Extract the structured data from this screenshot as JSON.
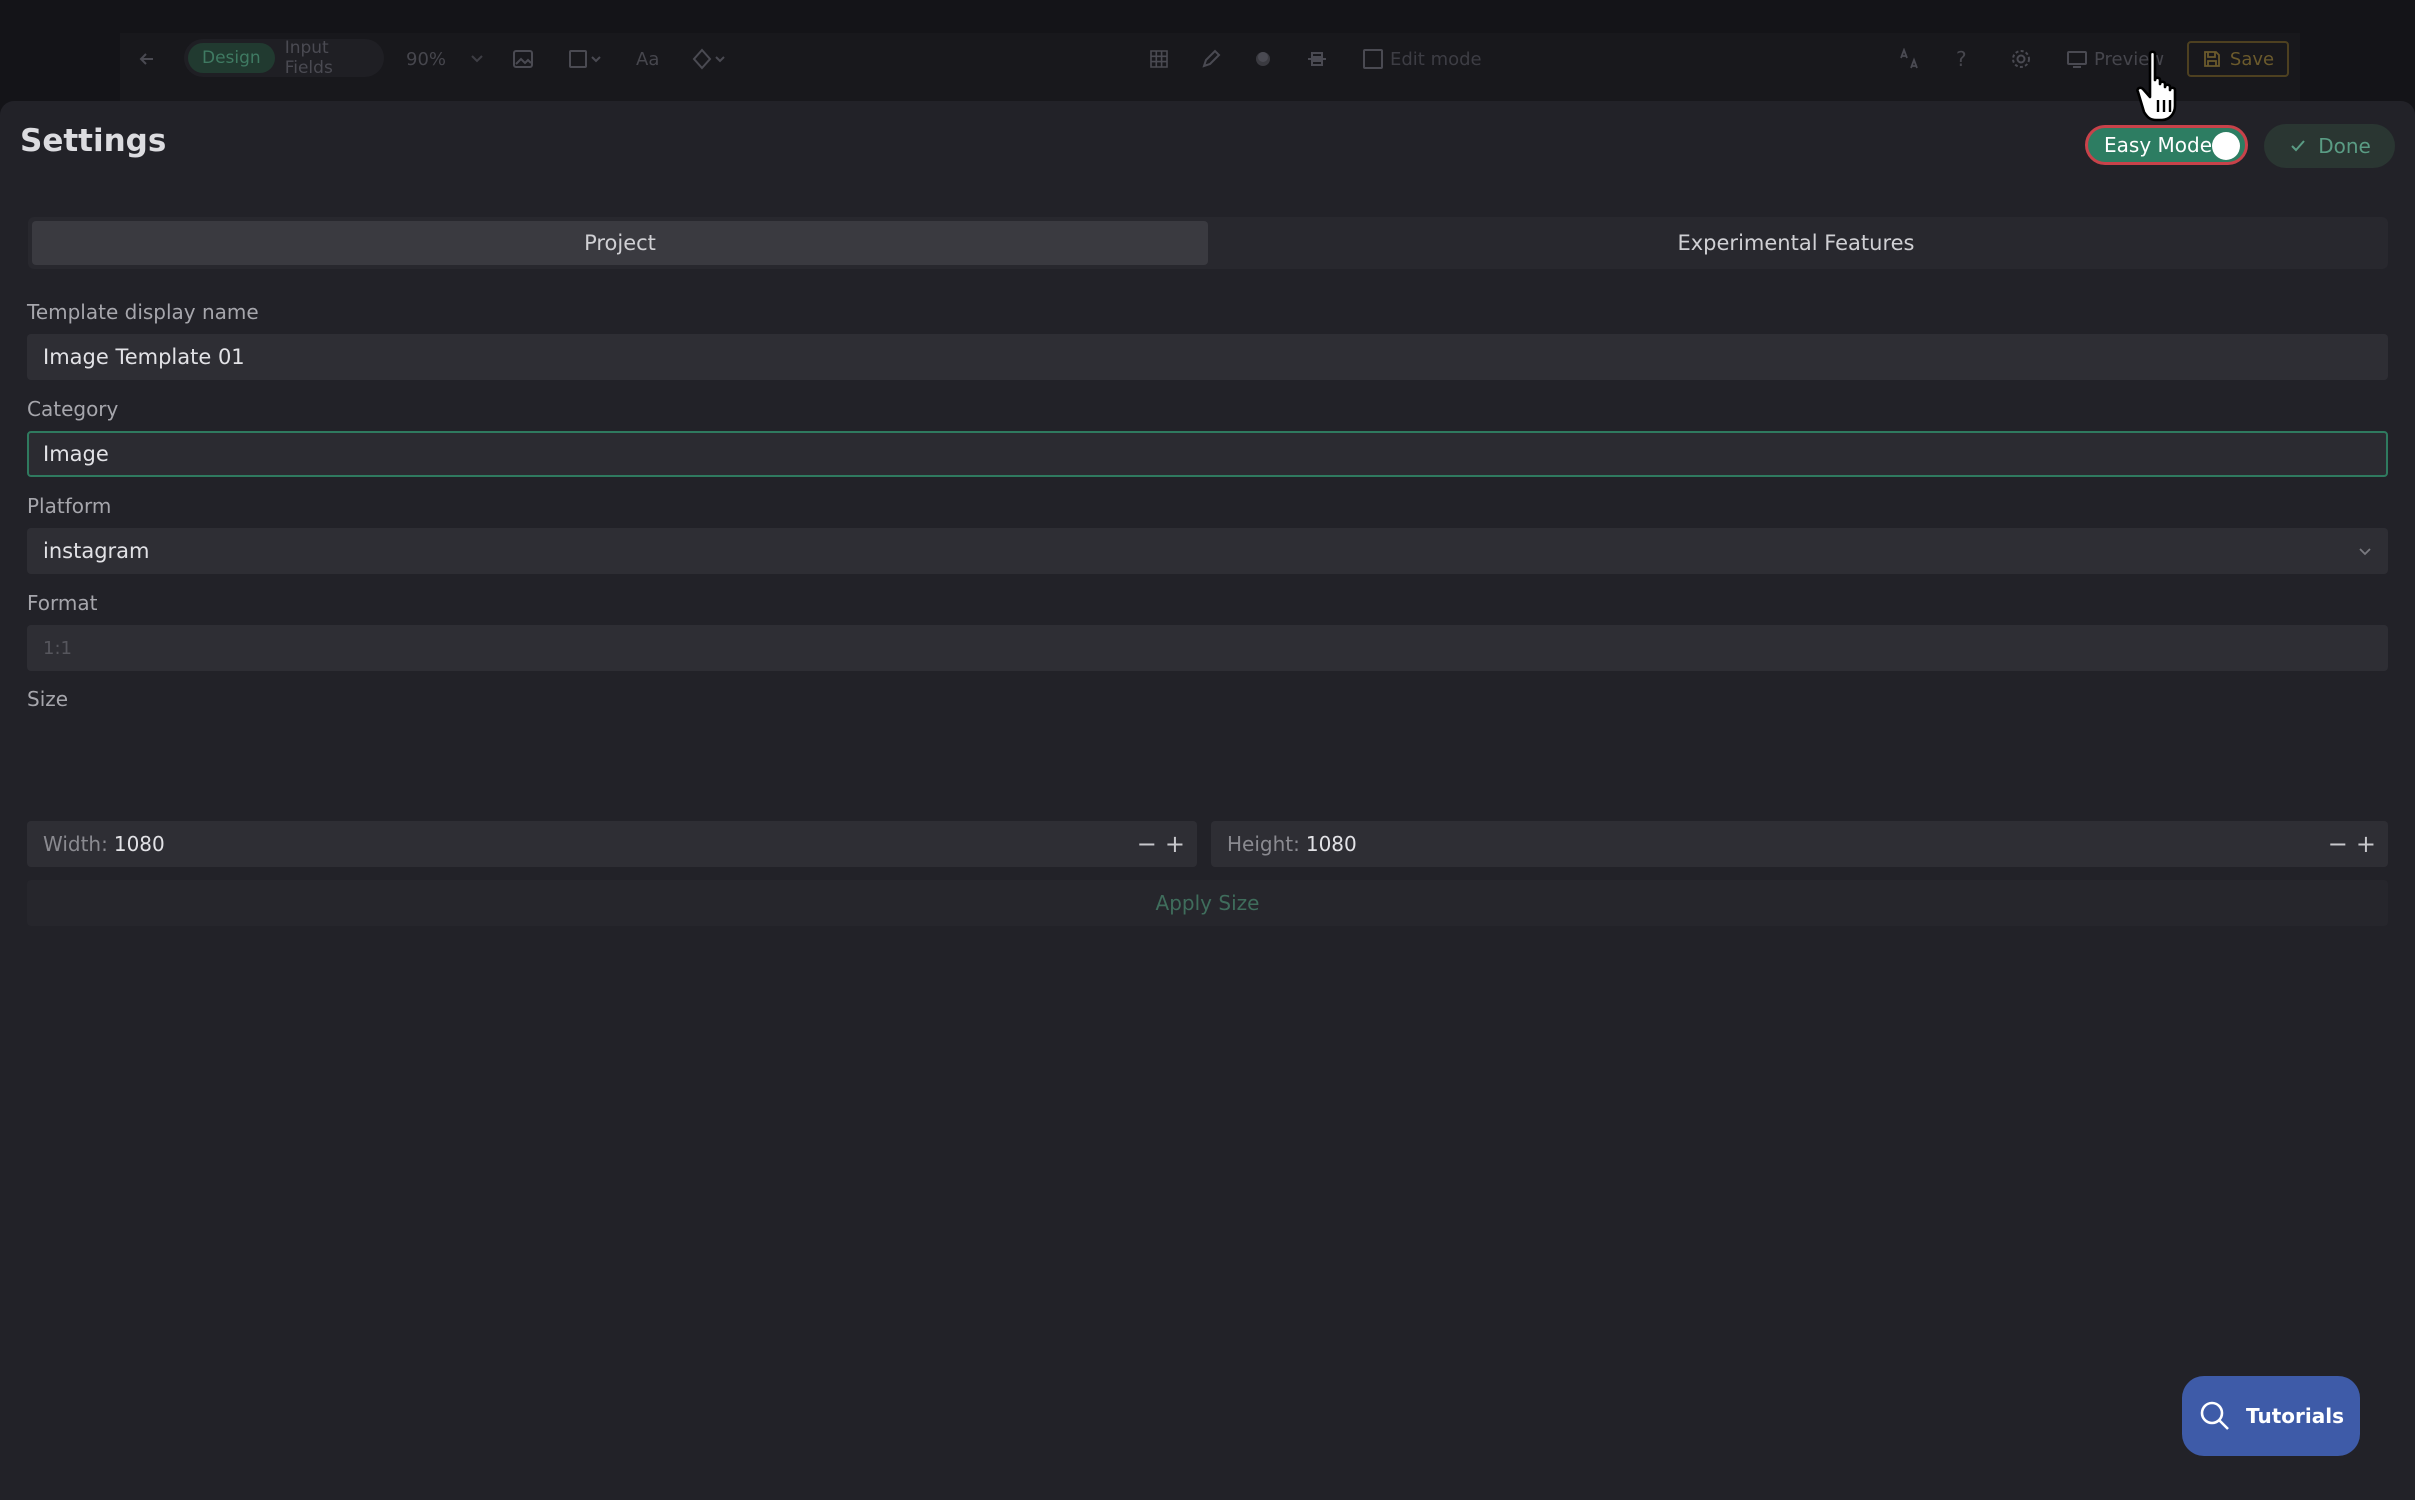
{
  "toolbar": {
    "mode_design": "Design",
    "mode_input_fields": "Input Fields",
    "zoom": "90%",
    "font_label": "Aa",
    "edit_mode": "Edit mode",
    "preview": "Preview",
    "save": "Save"
  },
  "settings": {
    "title": "Settings",
    "easy_mode_label": "Easy Mode",
    "easy_mode_on": true,
    "done_label": "Done",
    "tabs": [
      {
        "label": "Project",
        "active": true
      },
      {
        "label": "Experimental Features",
        "active": false
      }
    ],
    "fields": {
      "template_name": {
        "label": "Template display name",
        "value": "Image Template 01"
      },
      "category": {
        "label": "Category",
        "value": "Image"
      },
      "platform": {
        "label": "Platform",
        "value": "instagram"
      },
      "format": {
        "label": "Format",
        "value": "1:1"
      },
      "size": {
        "label": "Size",
        "width_label": "Width:",
        "width_value": "1080",
        "height_label": "Height:",
        "height_value": "1080",
        "minus": "−",
        "plus": "+"
      }
    },
    "apply_size": "Apply Size"
  },
  "tutorials": {
    "label": "Tutorials"
  },
  "icons": {
    "back": "arrow-left-icon",
    "image": "image-icon",
    "shape": "square-icon",
    "component": "diamond-icon",
    "grid": "grid-icon",
    "pen": "pen-icon",
    "fill": "droplet-icon",
    "align": "align-center-icon",
    "translate": "text-size-icon",
    "help": "question-icon",
    "settings": "gear-icon",
    "preview": "monitor-icon",
    "save": "save-icon",
    "check": "check-icon",
    "chevron": "chevron-down-icon",
    "search": "search-icon",
    "cursor": "hand-pointer-icon"
  },
  "colors": {
    "accent_green": "#2d7d62",
    "toggle_outline": "#c8424a",
    "tutorials_blue": "#3e5ba8",
    "panel_bg": "#222228"
  }
}
